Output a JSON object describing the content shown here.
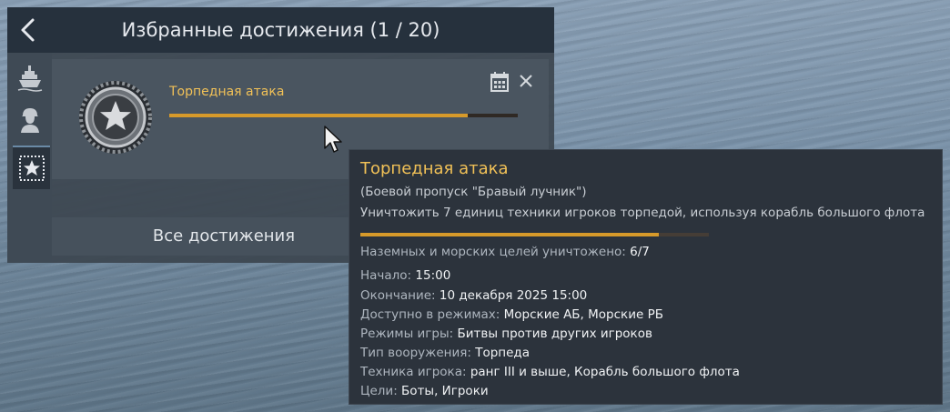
{
  "header": {
    "title": "Избранные достижения (1 / 20)"
  },
  "sidebar": {
    "tabs": [
      {
        "name": "ships",
        "icon": "ship-icon"
      },
      {
        "name": "soldier",
        "icon": "soldier-icon"
      },
      {
        "name": "achievements",
        "icon": "star-stamp-icon",
        "active": true
      }
    ]
  },
  "achievement": {
    "name": "Торпедная атака",
    "progress": 0.857,
    "medal_icon": "star-medal-icon"
  },
  "all_button_label": "Все достижения",
  "tooltip": {
    "title": "Торпедная атака",
    "subtitle": "(Боевой пропуск \"Бравый лучник\")",
    "description": "Уничтожить 7 единиц техники игроков торпедой, используя корабль большого флота",
    "progress": 0.857,
    "progress_label": "Наземных и морских целей уничтожено:",
    "progress_value": "6/7",
    "start_label": "Начало:",
    "start_value": "15:00",
    "end_label": "Окончание:",
    "end_value": "10 декабря 2025 15:00",
    "modes_label": "Доступно в режимах:",
    "modes_value": "Морские АБ, Морские РБ",
    "gametype_label": "Режимы игры:",
    "gametype_value": "Битвы против других игроков",
    "weapon_label": "Тип вооружения:",
    "weapon_value": "Торпеда",
    "vehicle_label": "Техника игрока:",
    "vehicle_value": "ранг III и выше, Корабль большого флота",
    "targets_label": "Цели:",
    "targets_value": "Боты, Игроки"
  },
  "colors": {
    "accent": "#f1c157",
    "progress": "#d79a2a",
    "panel": "#26313d"
  }
}
